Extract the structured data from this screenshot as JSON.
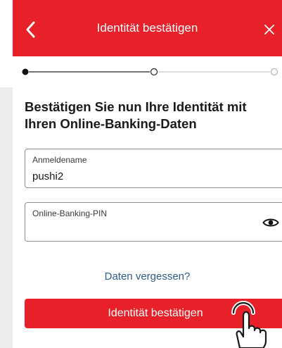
{
  "header": {
    "title": "Identität bestätigen",
    "back_icon": "chevron-left-icon",
    "close_icon": "close-icon"
  },
  "stepper": {
    "steps": 3,
    "current": 1
  },
  "main": {
    "heading": "Bestätigen Sie nun Ihre Identität mit Ihren Online-Banking-Daten",
    "username": {
      "label": "Anmeldename",
      "value": "pushi2"
    },
    "pin": {
      "label": "Online-Banking-PIN",
      "value": "",
      "toggle_icon": "eye-icon"
    },
    "forgot_link": "Daten vergessen?",
    "confirm_button": "Identität bestätigen"
  },
  "colors": {
    "brand": "#e8202a",
    "link": "#2e5c8a",
    "text": "#1a1a1a",
    "panel": "#ececec"
  }
}
